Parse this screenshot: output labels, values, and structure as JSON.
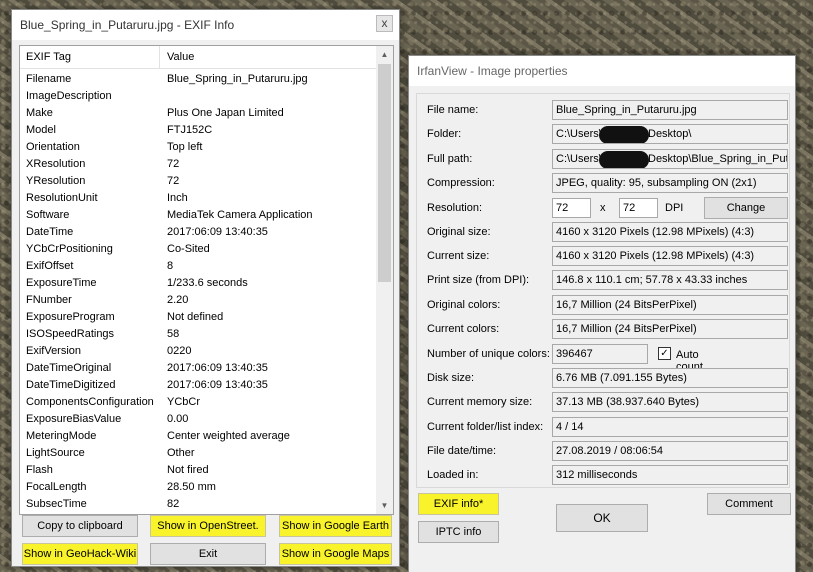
{
  "exif_window": {
    "title": "Blue_Spring_in_Putaruru.jpg - EXIF Info",
    "close_glyph": "x",
    "columns": [
      "EXIF Tag",
      "Value"
    ],
    "rows": [
      [
        "Filename",
        "Blue_Spring_in_Putaruru.jpg"
      ],
      [
        "ImageDescription",
        ""
      ],
      [
        "Make",
        "Plus One Japan Limited"
      ],
      [
        "Model",
        "FTJ152C"
      ],
      [
        "Orientation",
        "Top left"
      ],
      [
        "XResolution",
        "72"
      ],
      [
        "YResolution",
        "72"
      ],
      [
        "ResolutionUnit",
        "Inch"
      ],
      [
        "Software",
        "MediaTek Camera Application"
      ],
      [
        "DateTime",
        "2017:06:09 13:40:35"
      ],
      [
        "YCbCrPositioning",
        "Co-Sited"
      ],
      [
        "ExifOffset",
        "8"
      ],
      [
        "ExposureTime",
        "1/233.6 seconds"
      ],
      [
        "FNumber",
        "2.20"
      ],
      [
        "ExposureProgram",
        "Not defined"
      ],
      [
        "ISOSpeedRatings",
        "58"
      ],
      [
        "ExifVersion",
        "0220"
      ],
      [
        "DateTimeOriginal",
        "2017:06:09 13:40:35"
      ],
      [
        "DateTimeDigitized",
        "2017:06:09 13:40:35"
      ],
      [
        "ComponentsConfiguration",
        "YCbCr"
      ],
      [
        "ExposureBiasValue",
        "0.00"
      ],
      [
        "MeteringMode",
        "Center weighted average"
      ],
      [
        "LightSource",
        "Other"
      ],
      [
        "Flash",
        "Not fired"
      ],
      [
        "FocalLength",
        "28.50 mm"
      ],
      [
        "SubsecTime",
        "82"
      ]
    ],
    "buttons": {
      "copy": "Copy to clipboard",
      "openstreet": "Show in OpenStreet.",
      "google_earth": "Show in Google Earth",
      "geohack": "Show in GeoHack-Wiki",
      "exit": "Exit",
      "google_maps": "Show in Google Maps"
    }
  },
  "irfan_window": {
    "title": "IrfanView - Image properties",
    "fields": {
      "file_name": {
        "label": "File name:",
        "value": "Blue_Spring_in_Putaruru.jpg"
      },
      "folder": {
        "label": "Folder:",
        "value_start": "C:\\Users\\",
        "value_end": "Desktop\\"
      },
      "full_path": {
        "label": "Full path:",
        "value_start": "C:\\Users\\",
        "value_end": "Desktop\\Blue_Spring_in_Puta"
      },
      "compression": {
        "label": "Compression:",
        "value": "JPEG, quality: 95, subsampling ON (2x1)"
      },
      "resolution": {
        "label": "Resolution:",
        "x": "72",
        "separator": "x",
        "y": "72",
        "unit": "DPI",
        "change_button": "Change"
      },
      "original_size": {
        "label": "Original size:",
        "value": "4160 x 3120  Pixels (12.98 MPixels) (4:3)"
      },
      "current_size": {
        "label": "Current size:",
        "value": "4160 x 3120  Pixels (12.98 MPixels) (4:3)"
      },
      "print_size": {
        "label": "Print size (from DPI):",
        "value": "146.8 x 110.1 cm; 57.78 x 43.33 inches"
      },
      "original_colors": {
        "label": "Original colors:",
        "value": "16,7 Million   (24 BitsPerPixel)"
      },
      "current_colors": {
        "label": "Current colors:",
        "value": "16,7 Million   (24 BitsPerPixel)"
      },
      "unique_colors": {
        "label": "Number of unique colors:",
        "value": "396467",
        "auto_count_label": "Auto count",
        "auto_count_checked": "✓"
      },
      "disk_size": {
        "label": "Disk size:",
        "value": "6.76 MB (7.091.155 Bytes)"
      },
      "memory_size": {
        "label": "Current memory size:",
        "value": "37.13  MB (38.937.640 Bytes)"
      },
      "folder_index": {
        "label": "Current folder/list index:",
        "value": "4  /  14"
      },
      "file_date": {
        "label": "File date/time:",
        "value": "27.08.2019 / 08:06:54"
      },
      "loaded_in": {
        "label": "Loaded in:",
        "value": "312 milliseconds"
      }
    },
    "buttons": {
      "exif_info": "EXIF info*",
      "ok": "OK",
      "comment": "Comment",
      "iptc_info": "IPTC info"
    }
  },
  "colors": {
    "highlight": "#f8f32a",
    "window_bg": "#f0f0f0",
    "redaction": "#111111"
  }
}
